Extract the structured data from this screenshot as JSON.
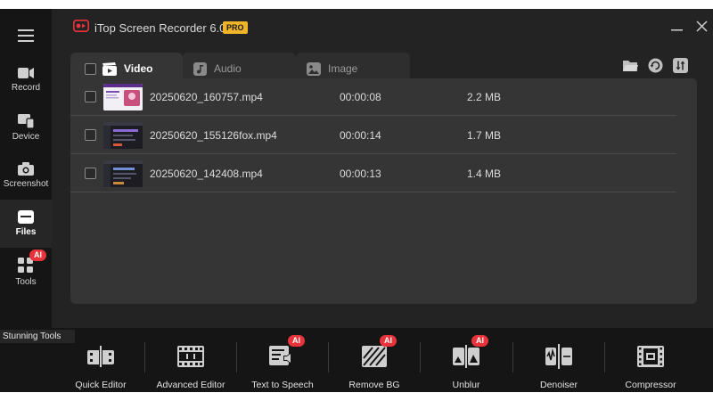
{
  "app": {
    "title": "iTop Screen Recorder 6.0",
    "badge": "PRO",
    "accent": "#e8333a"
  },
  "sidebar": {
    "items": [
      {
        "label": "Record",
        "icon": "record-icon"
      },
      {
        "label": "Device",
        "icon": "device-icon"
      },
      {
        "label": "Screenshot",
        "icon": "camera-icon"
      },
      {
        "label": "Files",
        "icon": "folder-icon",
        "active": true
      },
      {
        "label": "Tools",
        "icon": "tools-grid-icon",
        "badge": "AI"
      }
    ]
  },
  "tabs": [
    {
      "label": "Video",
      "active": true
    },
    {
      "label": "Audio"
    },
    {
      "label": "Image"
    }
  ],
  "files": [
    {
      "name": "20250620_160757.mp4",
      "duration": "00:00:08",
      "size": "2.2 MB"
    },
    {
      "name": "20250620_155126fox.mp4",
      "duration": "00:00:14",
      "size": "1.7 MB"
    },
    {
      "name": "20250620_142408.mp4",
      "duration": "00:00:13",
      "size": "1.4 MB"
    }
  ],
  "bottom": {
    "title": "Stunning Tools",
    "tools": [
      {
        "label": "Quick Editor"
      },
      {
        "label": "Advanced Editor"
      },
      {
        "label": "Text to Speech",
        "badge": "AI"
      },
      {
        "label": "Remove BG",
        "badge": "AI"
      },
      {
        "label": "Unblur",
        "badge": "AI"
      },
      {
        "label": "Denoiser"
      },
      {
        "label": "Compressor"
      }
    ]
  }
}
